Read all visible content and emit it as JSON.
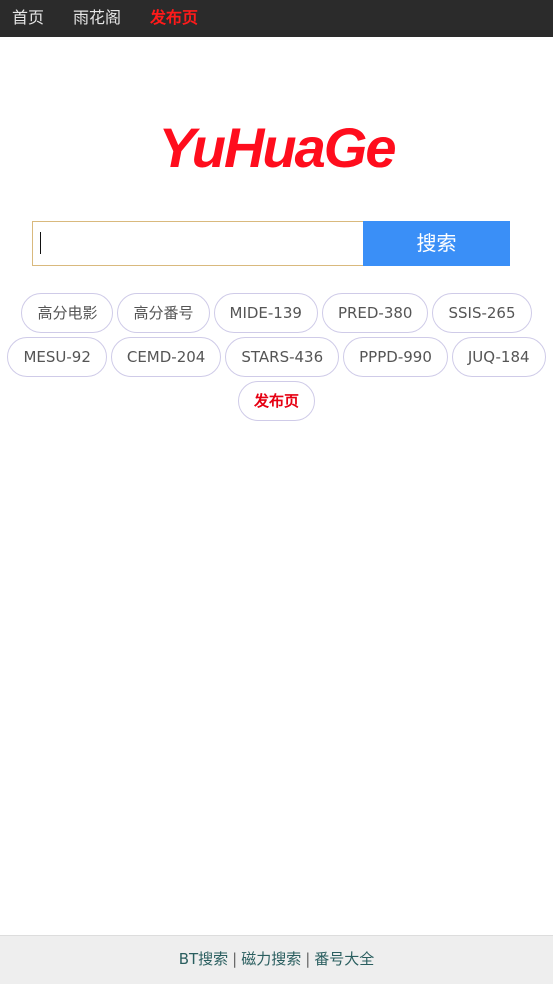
{
  "nav": {
    "items": [
      {
        "label": "首页"
      },
      {
        "label": "雨花阁"
      },
      {
        "label": "发布页"
      }
    ],
    "active_color": "#ff1a1a"
  },
  "logo": {
    "text": "YuHuaGe",
    "color": "#ff0d1d"
  },
  "search": {
    "value": "",
    "button_label": "搜索",
    "button_color": "#3a8ff7"
  },
  "tags": {
    "row1": [
      "高分电影",
      "高分番号",
      "MIDE-139",
      "PRED-380",
      "SSIS-265"
    ],
    "row2": [
      "MESU-92",
      "CEMD-204",
      "STARS-436",
      "PPPD-990",
      "JUQ-184"
    ],
    "row3": [
      "发布页"
    ]
  },
  "footer": {
    "links": [
      "BT搜索",
      "磁力搜索",
      "番号大全"
    ],
    "separator": "|"
  }
}
